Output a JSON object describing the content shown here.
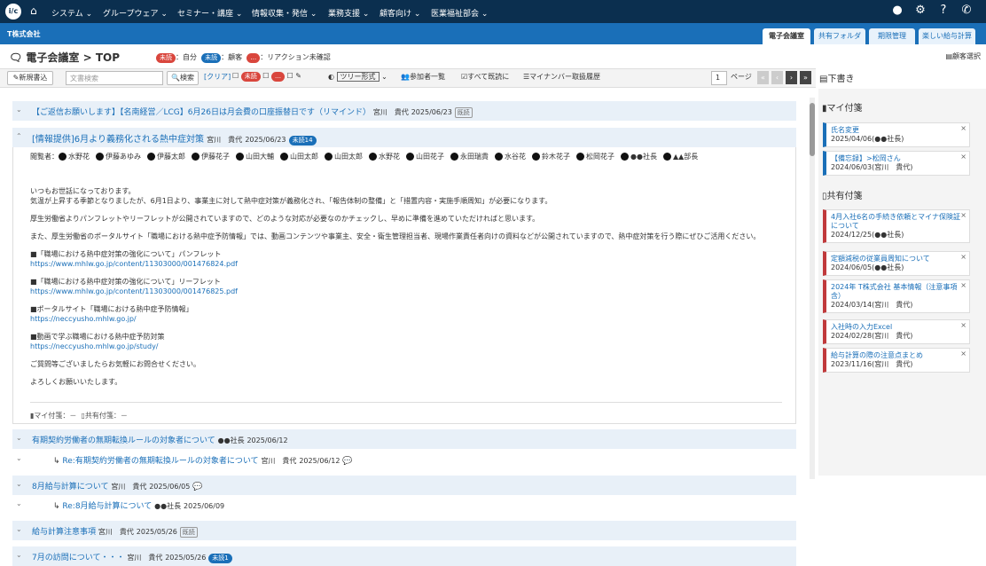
{
  "nav": {
    "logo": "i/c",
    "menus": [
      "システム",
      "グループウェア",
      "セミナー・講座",
      "情報収集・発信",
      "業務支援",
      "顧客向け",
      "医業福祉部会"
    ]
  },
  "company": "T株式会社",
  "tabs": [
    "電子会議室",
    "共有フォルダ",
    "期限管理",
    "楽しい給与計算"
  ],
  "page": {
    "title": "電子会議室 > TOP",
    "legend": [
      {
        "badge": "未読",
        "text": "：自分"
      },
      {
        "badge": "未読",
        "text": "：顧客"
      },
      {
        "badge": "…",
        "text": "：リアクション未確認"
      }
    ],
    "customer_select": "顧客選択"
  },
  "toolbar": {
    "new_post": "新規書込",
    "search_placeholder": "文書検索",
    "search_btn": "検索",
    "clear": "[クリア]",
    "view_mode": "ツリー形式",
    "participants": "参加者一覧",
    "mark_all_read": "すべて既読に",
    "my_number": "マイナンバー取扱履歴",
    "page_num": "1",
    "page_label": "ページ"
  },
  "threads_top": [
    {
      "title": "【ご返信お願いします】【名南経営／LCG】6月26日は月会費の口座振替日です（リマインド）",
      "author": "宮川　貴代",
      "date": "2025/06/23",
      "tag": "既読"
    }
  ],
  "opened": {
    "title": "[情報提供]6月より義務化される熱中症対策",
    "author": "宮川　貴代",
    "date": "2025/06/23",
    "badge": "未読14",
    "viewers_label": "閲覧者：",
    "viewers": [
      "水野花",
      "伊藤あゆみ",
      "伊藤太郎",
      "伊藤花子",
      "山田大輔",
      "山田太郎",
      "山田太郎",
      "水野花",
      "山田花子",
      "永田瑞貴",
      "水谷花",
      "鈴木花子",
      "松岡花子",
      "●●社長",
      "▲▲部長"
    ],
    "body": [
      "いつもお世話になっております。",
      "気温が上昇する季節となりましたが、6月1日より、事業主に対して熱中症対策が義務化され、「報告体制の整備」と「措置内容・実施手順周知」が必要になります。",
      "",
      "厚生労働省よりパンフレットやリーフレットが公開されていますので、どのような対応が必要なのかチェックし、早めに準備を進めていただければと思います。",
      "",
      "また、厚生労働省のポータルサイト「職場における熱中症予防情報」では、動画コンテンツや事業主、安全・衛生管理担当者、現場作業責任者向けの資料などが公開されていますので、熱中症対策を行う際にぜひご活用ください。",
      "",
      "■「職場における熱中症対策の強化について」パンフレット",
      "https://www.mhlw.go.jp/content/11303000/001476824.pdf",
      "",
      "■「職場における熱中症対策の強化について」リーフレット",
      "https://www.mhlw.go.jp/content/11303000/001476825.pdf",
      "",
      "■ポータルサイト「職場における熱中症予防情報」",
      "https://neccyusho.mhlw.go.jp/",
      "",
      "■動画で学ぶ職場における熱中症予防対策",
      "https://neccyusho.mhlw.go.jp/study/",
      "",
      "ご質問等ございましたらお気軽にお問合せください。",
      "",
      "よろしくお願いいたします。"
    ],
    "my_notes": "マイ付箋：－",
    "shared_notes": "共有付箋：－"
  },
  "threads": [
    {
      "title": "有期契約労働者の無期転換ルールの対象者について",
      "author": "●●社長",
      "date": "2025/06/12",
      "reply": false
    },
    {
      "title": "Re:有期契約労働者の無期転換ルールの対象者について",
      "author": "宮川　貴代",
      "date": "2025/06/12",
      "reply": true
    },
    {
      "title": "8月給与計算について",
      "author": "宮川　貴代",
      "date": "2025/06/05",
      "reply": false
    },
    {
      "title": "Re:8月給与計算について",
      "author": "●●社長",
      "date": "2025/06/09",
      "reply": true
    },
    {
      "title": "給与計算注意事項",
      "author": "宮川　貴代",
      "date": "2025/05/26",
      "reply": false,
      "tag": "既読"
    },
    {
      "title": "7月の訪問について・・・",
      "author": "宮川　貴代",
      "date": "2025/05/26",
      "reply": false,
      "badge": "未読1"
    }
  ],
  "right": {
    "header": "下書き",
    "my_notes": "マイ付箋",
    "my_cards": [
      {
        "title": "氏名変更",
        "date": "2025/04/06(●●社長)"
      },
      {
        "title": "【備忘録】>松岡さん",
        "date": "2024/06/03(宮川　貴代)"
      }
    ],
    "shared_notes": "共有付箋",
    "shared_cards": [
      {
        "title": "4月入社6名の手続き依頼とマイナ保険証について",
        "date": "2024/12/25(●●社長)"
      },
      {
        "title": "定額減税の従業員周知について",
        "date": "2024/06/05(●●社長)"
      },
      {
        "title": "2024年 T株式会社 基本情報（注意事項含）",
        "date": "2024/03/14(宮川　貴代)"
      },
      {
        "title": "入社時の入力Excel",
        "date": "2024/02/28(宮川　貴代)"
      },
      {
        "title": "給与計算の際の注意点まとめ",
        "date": "2023/11/16(宮川　貴代)"
      }
    ]
  }
}
